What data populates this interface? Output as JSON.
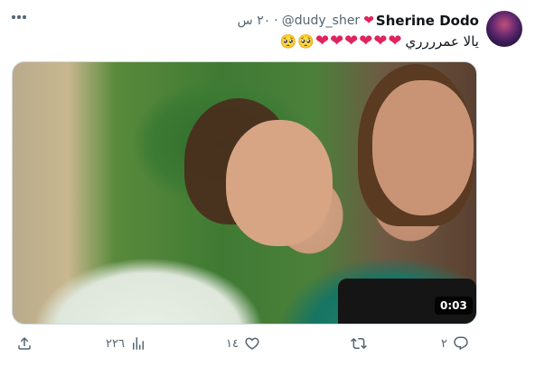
{
  "tweet": {
    "display_name": "Sherine Dodo",
    "name_emoji": "❤",
    "handle": "@dudy_sher",
    "separator": "·",
    "timestamp": "٢٠ س",
    "text": "يالا عمرررري",
    "text_emojis": [
      "🥺",
      "🥺",
      "❤",
      "❤",
      "❤",
      "❤",
      "❤",
      "❤"
    ]
  },
  "media": {
    "duration": "0:03"
  },
  "actions": {
    "replies": "٢",
    "retweets": "",
    "likes": "١٤",
    "views": "٢٢٦"
  },
  "colors": {
    "heart": "#e0245e",
    "muted": "#536471"
  }
}
